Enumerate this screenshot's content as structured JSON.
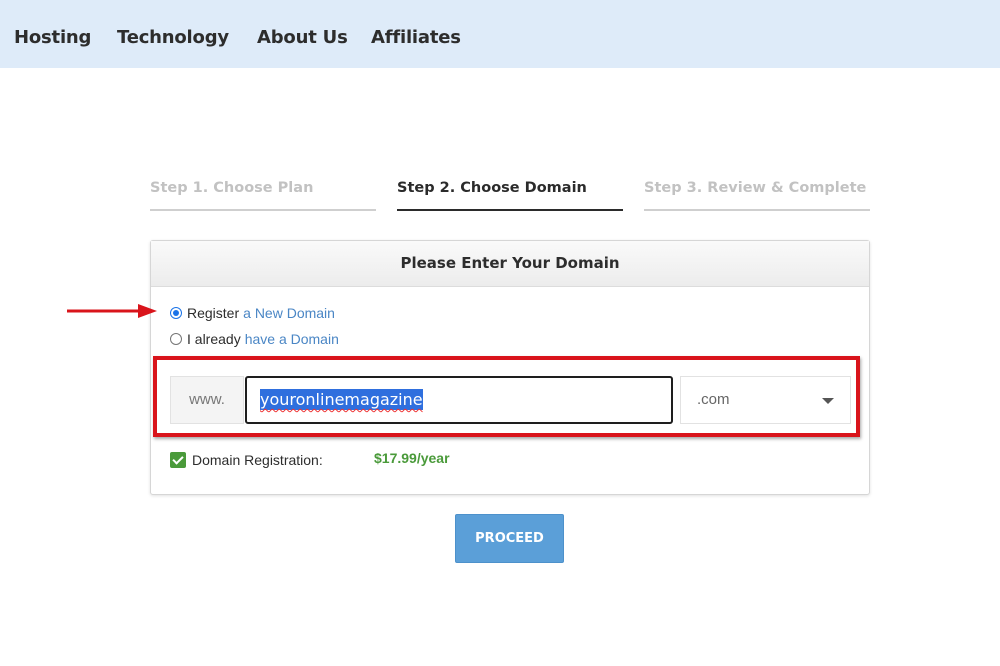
{
  "nav": {
    "items": [
      {
        "label": "Hosting"
      },
      {
        "label": "Technology"
      },
      {
        "label": "About Us"
      },
      {
        "label": "Affiliates"
      }
    ]
  },
  "steps": [
    {
      "label": "Step 1. Choose Plan",
      "state": "inactive"
    },
    {
      "label": "Step 2. Choose Domain",
      "state": "active"
    },
    {
      "label": "Step 3. Review & Complete",
      "state": "inactive"
    }
  ],
  "panel": {
    "title": "Please Enter Your Domain",
    "options": [
      {
        "prefix": "Register",
        "link": "a New Domain",
        "selected": true
      },
      {
        "prefix": "I already",
        "link": "have a Domain",
        "selected": false
      }
    ],
    "domain": {
      "prefix": "www.",
      "value": "youronlinemagazine",
      "tld": ".com"
    },
    "registration": {
      "label": "Domain Registration:",
      "price": "$17.99/year",
      "checked": true
    }
  },
  "proceed_label": "PROCEED",
  "colors": {
    "nav_bg": "#deebf9",
    "link": "#4a86c5",
    "price": "#4a9a3a",
    "button": "#5b9fd8",
    "annotation": "#d9141b"
  },
  "annotations": {
    "arrow_icon": "red-arrow-icon",
    "highlight": "red-highlight-box"
  }
}
